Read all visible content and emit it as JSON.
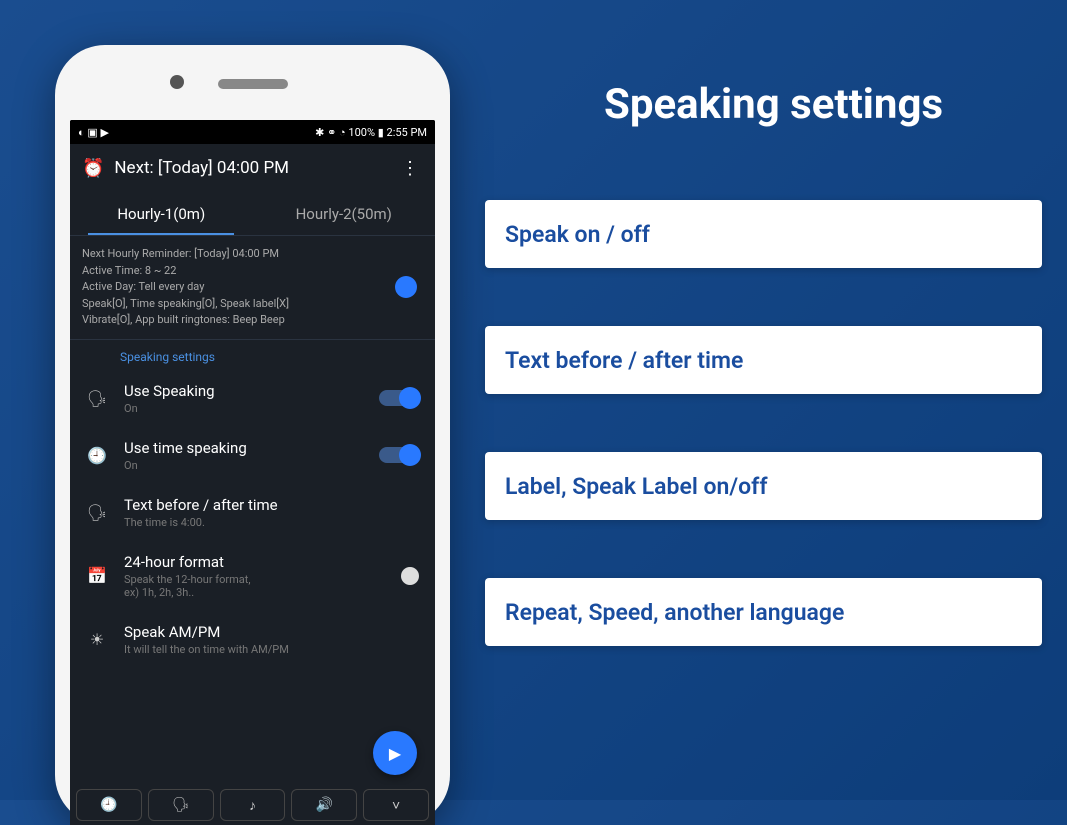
{
  "promo": {
    "title": "Speaking settings",
    "cards": [
      "Speak on / off",
      "Text before / after time",
      "Label, Speak Label on/off",
      "Repeat, Speed, another language"
    ]
  },
  "statusbar": {
    "left_icons": "◐ ▣ ▶",
    "right": "✱ ⚭ ◔ 100% ▮ 2:55 PM"
  },
  "appbar": {
    "title": "Next: [Today] 04:00 PM"
  },
  "tabs": [
    "Hourly-1(0m)",
    "Hourly-2(50m)"
  ],
  "info": {
    "line1": "Next Hourly Reminder: [Today] 04:00 PM",
    "line2": "Active Time: 8 ~ 22",
    "line3": "Active Day: Tell every day",
    "line4": "Speak[O], Time speaking[O], Speak label[X]",
    "line5": "Vibrate[O], App built ringtones: Beep Beep"
  },
  "section_title": "Speaking settings",
  "settings": {
    "use_speaking": {
      "title": "Use Speaking",
      "sub": "On"
    },
    "use_time_speaking": {
      "title": "Use time speaking",
      "sub": "On"
    },
    "text_ba": {
      "title": "Text before / after time",
      "sub": "The time is 4:00."
    },
    "hr24": {
      "title": "24-hour format",
      "sub": "Speak the 12-hour format,\nex) 1h, 2h, 3h.."
    },
    "ampm": {
      "title": "Speak AM/PM",
      "sub": "It will tell the on time with AM/PM"
    }
  }
}
